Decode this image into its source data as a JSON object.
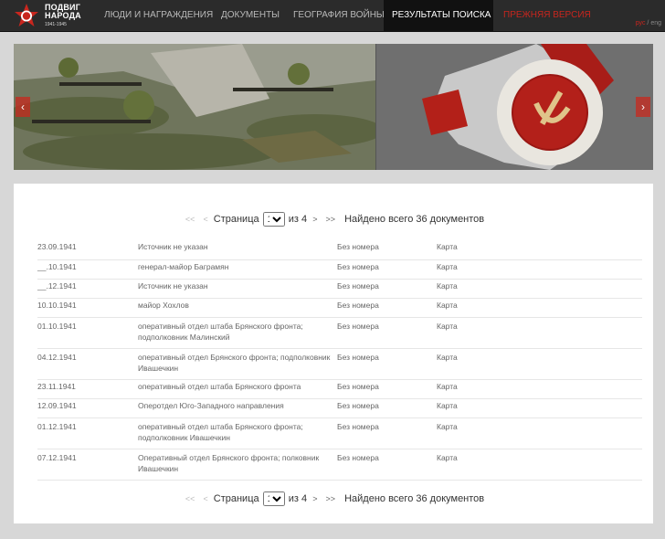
{
  "logo": {
    "title_line1": "ПОДВИГ",
    "title_line2": "НАРОДА",
    "years": "1941-1945"
  },
  "nav": [
    {
      "label": "Люди и награждения"
    },
    {
      "label": "Документы"
    },
    {
      "label": "География войны"
    },
    {
      "label": "Результаты поиска"
    },
    {
      "label": "Прежняя версия"
    }
  ],
  "lang": {
    "ru": "рус",
    "sep": " / ",
    "en": "eng"
  },
  "pager": {
    "first": "<<",
    "prev": "<",
    "label": "Страница",
    "current": "1",
    "of": "из 4",
    "next": ">",
    "last": ">>",
    "found": "Найдено всего 36 документов"
  },
  "rows": [
    {
      "date": "23.09.1941",
      "source": "Источник не указан",
      "number": "Без номера",
      "map": "Карта"
    },
    {
      "date": "__.10.1941",
      "source": "генерал-майор Баграмян",
      "number": "Без номера",
      "map": "Карта"
    },
    {
      "date": "__.12.1941",
      "source": "Источник не указан",
      "number": "Без номера",
      "map": "Карта"
    },
    {
      "date": "10.10.1941",
      "source": "майор Хохлов",
      "number": "Без номера",
      "map": "Карта"
    },
    {
      "date": "01.10.1941",
      "source": "оперативный отдел штаба Брянского фронта; подполковник Малинский",
      "number": "Без номера",
      "map": "Карта"
    },
    {
      "date": "04.12.1941",
      "source": "оперативный отдел Брянского фронта; подполковник Ивашечкин",
      "number": "Без номера",
      "map": "Карта"
    },
    {
      "date": "23.11.1941",
      "source": "оперативный отдел штаба Брянского фронта",
      "number": "Без номера",
      "map": "Карта"
    },
    {
      "date": "12.09.1941",
      "source": "Оперотдел Юго-Западного направления",
      "number": "Без номера",
      "map": "Карта"
    },
    {
      "date": "01.12.1941",
      "source": "оперативный отдел штаба Брянского фронта; подполковник Ивашечкин",
      "number": "Без номера",
      "map": "Карта"
    },
    {
      "date": "07.12.1941",
      "source": "Оперативный отдел Брянского фронта; полковник Ивашечкин",
      "number": "Без номера",
      "map": "Карта"
    }
  ]
}
